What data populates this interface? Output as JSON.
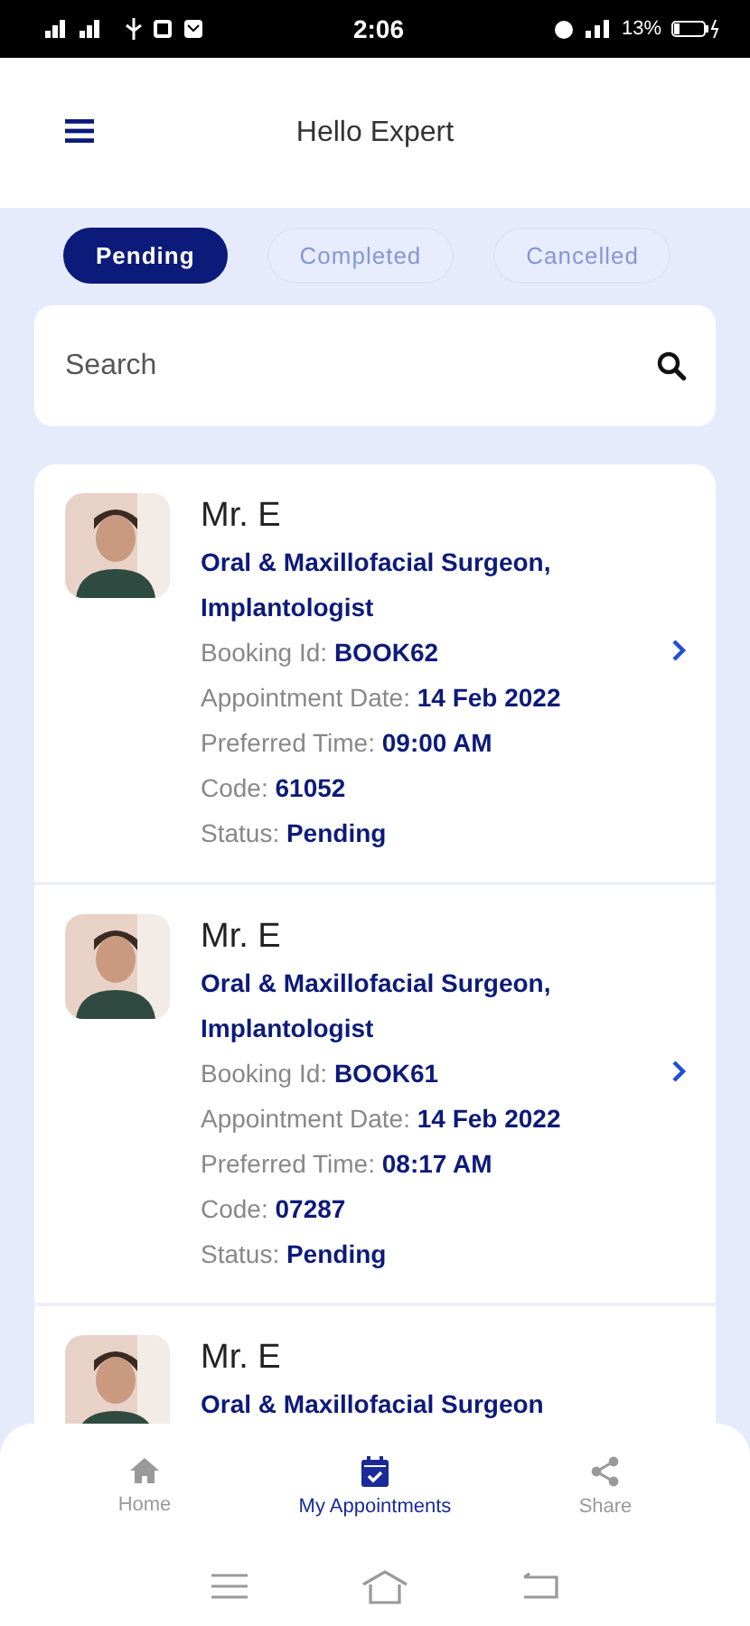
{
  "status_bar": {
    "time": "2:06",
    "battery": "13%"
  },
  "header": {
    "title": "Hello Expert"
  },
  "tabs": [
    {
      "label": "Pending",
      "selected": true
    },
    {
      "label": "Completed",
      "selected": false
    },
    {
      "label": "Cancelled",
      "selected": false
    }
  ],
  "search": {
    "placeholder": "Search"
  },
  "appointments": [
    {
      "name": "Mr. E",
      "specialty": "Oral & Maxillofacial Surgeon, Implantologist",
      "fields": [
        {
          "label": "Booking Id:",
          "value": "BOOK62"
        },
        {
          "label": "Appointment Date:",
          "value": "14 Feb 2022"
        },
        {
          "label": "Preferred Time:",
          "value": "09:00 AM"
        },
        {
          "label": "Code:",
          "value": "61052"
        },
        {
          "label": "Status:",
          "value": "Pending"
        }
      ]
    },
    {
      "name": "Mr. E",
      "specialty": "Oral & Maxillofacial Surgeon, Implantologist",
      "fields": [
        {
          "label": "Booking Id:",
          "value": "BOOK61"
        },
        {
          "label": "Appointment Date:",
          "value": "14 Feb 2022"
        },
        {
          "label": "Preferred Time:",
          "value": "08:17 AM"
        },
        {
          "label": "Code:",
          "value": "07287"
        },
        {
          "label": "Status:",
          "value": "Pending"
        }
      ]
    },
    {
      "name": "Mr. E",
      "specialty": "Oral & Maxillofacial Surgeon"
    }
  ],
  "bottom_nav": [
    {
      "label": "Home",
      "kind": "home",
      "selected": false
    },
    {
      "label": "My Appointments",
      "kind": "calendar",
      "selected": true
    },
    {
      "label": "Share",
      "kind": "share",
      "selected": false
    }
  ]
}
